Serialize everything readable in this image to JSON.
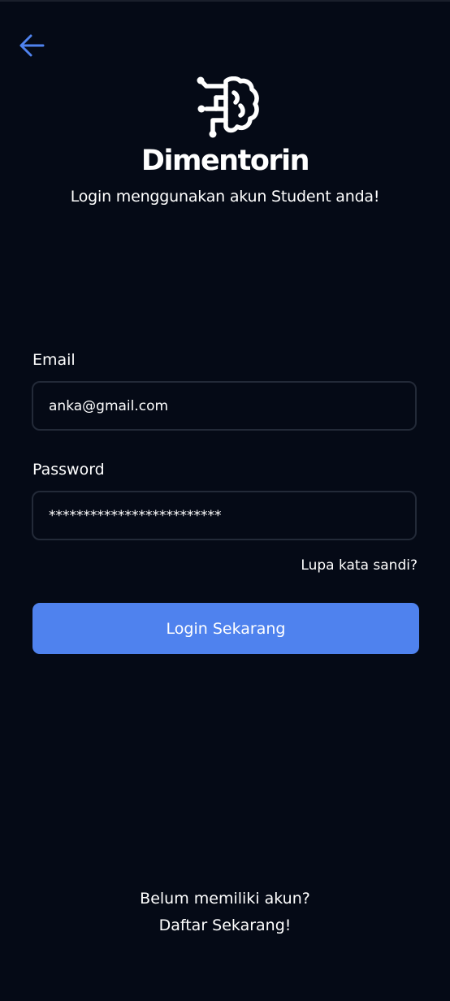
{
  "app": {
    "brand_name": "Dimentorin",
    "subtitle": "Login menggunakan akun Student anda!"
  },
  "form": {
    "email_label": "Email",
    "email_value": "anka@gmail.com",
    "password_label": "Password",
    "password_value": "*************************",
    "forgot_password": "Lupa kata sandi?",
    "submit_label": "Login Sekarang"
  },
  "footer": {
    "prompt": "Belum memiliki akun?",
    "register_link": "Daftar Sekarang!"
  },
  "icons": {
    "back": "arrow-left-icon",
    "logo": "brain-circuit-icon"
  },
  "colors": {
    "background": "#050a16",
    "accent": "#4f82ee",
    "input_border": "#232a38",
    "text": "#ffffff"
  }
}
